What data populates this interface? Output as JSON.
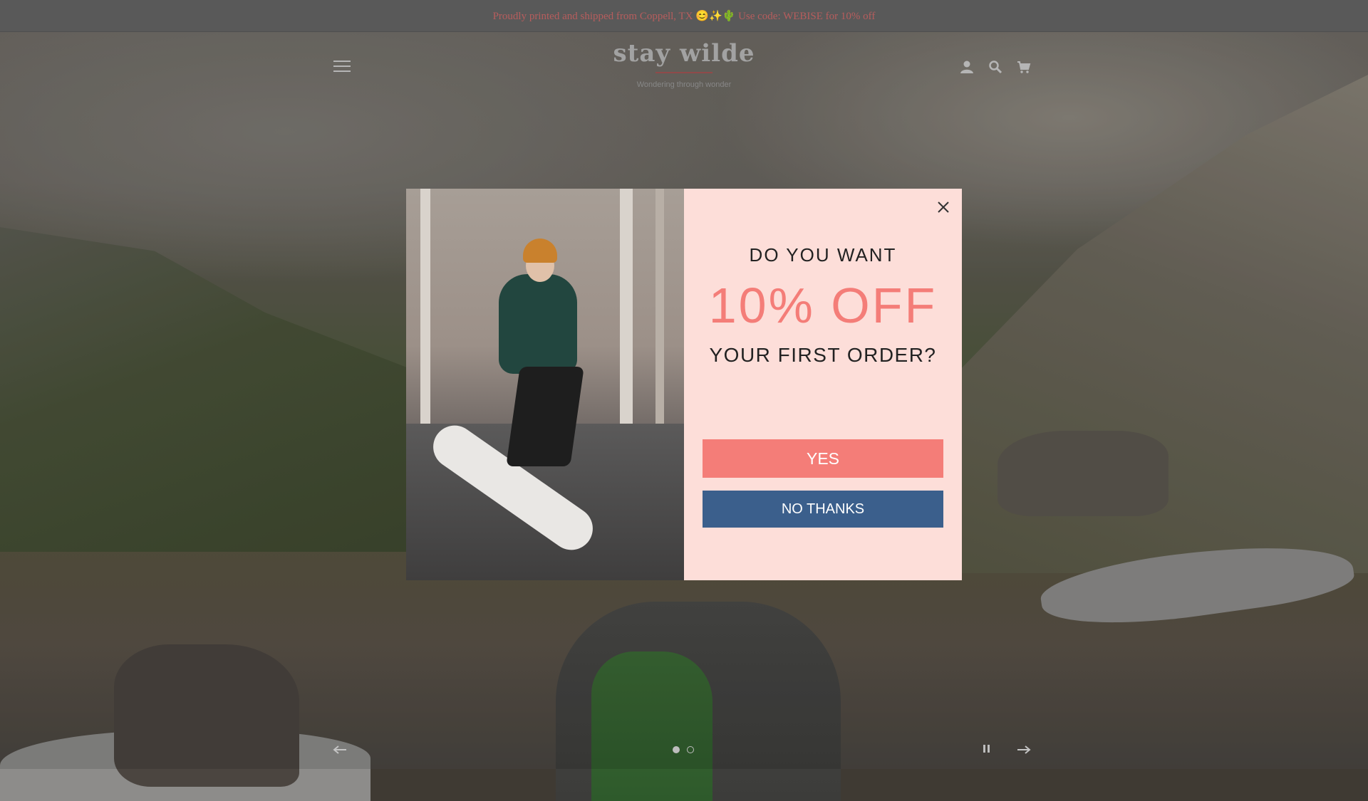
{
  "announcement": {
    "text": "Proudly printed and shipped from Coppell, TX 😊✨🌵 Use code: WEBISE for 10% off",
    "color": "#b75d5d"
  },
  "header": {
    "logo_text": "stay wilde",
    "tagline": "Wondering through wonder",
    "icons": [
      "menu-icon",
      "account-icon",
      "search-icon",
      "cart-icon"
    ]
  },
  "popup": {
    "line1": "DO YOU WANT",
    "line2": "10% OFF",
    "line3": "YOUR FIRST ORDER?",
    "yes_label": "YES",
    "no_label": "NO THANKS",
    "colors": {
      "panel": "#fdded9",
      "accent": "#f47d78",
      "secondary": "#3b5f8c"
    }
  },
  "slideshow": {
    "slide_count": 2,
    "active_slide": 1,
    "icons": [
      "arrow-left-icon",
      "pause-icon",
      "arrow-right-icon"
    ]
  }
}
